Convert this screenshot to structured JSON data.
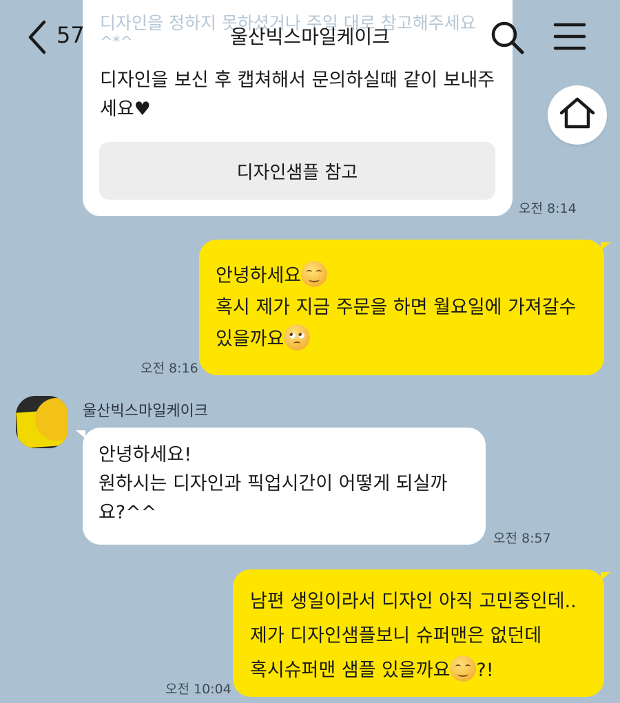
{
  "header": {
    "faded_text_line1": "디자인을 정하지 못하셨거나 주일 대로 참고해주세요",
    "faded_text_line2": "^*^",
    "unread_count": "57",
    "title": "울산빅스마일케이크"
  },
  "messages": {
    "m1": {
      "text": "디자인을 보신 후 캡쳐해서 문의하실때 같이 보내주세요♥",
      "button_label": "디자인샘플 참고",
      "time": "오전 8:14"
    },
    "m2": {
      "line1": "안녕하세요",
      "line2": "혹시 제가 지금 주문을 하면 월요일에 가져갈수",
      "line3": "있을까요",
      "time": "오전 8:16"
    },
    "m3": {
      "sender": "울산빅스마일케이크",
      "line1": "안녕하세요!",
      "line2": "원하시는 디자인과 픽업시간이 어떻게 되실까",
      "line3": "요?^^",
      "time": "오전 8:57"
    },
    "m4": {
      "line1": "남편 생일이라서 디자인 아직 고민중인데..",
      "line2": "제가 디자인샘플보니 슈퍼맨은 없던데",
      "line3": "혹시슈퍼맨 샘플 있을까요",
      "line3_suffix": "?!",
      "time": "오전 10:04"
    }
  },
  "icons": {
    "back": "chevron-left-icon",
    "search": "search-icon",
    "menu": "hamburger-menu-icon",
    "home": "home-icon"
  },
  "colors": {
    "background": "#abc1d1",
    "my_bubble": "#fee500",
    "their_bubble": "#ffffff"
  }
}
